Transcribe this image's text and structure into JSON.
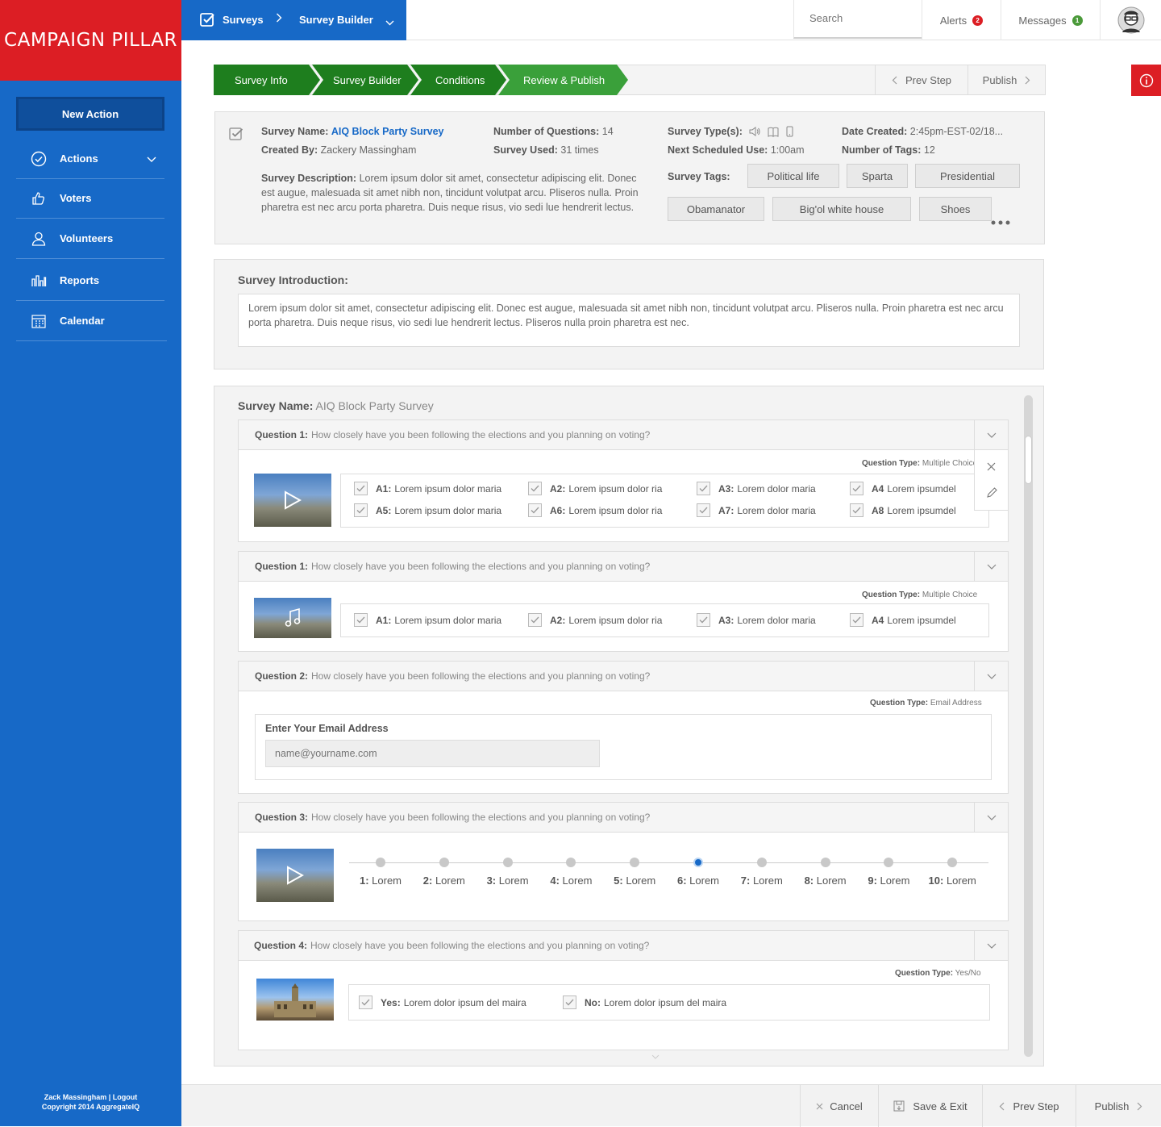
{
  "brand": {
    "logo_text": "CAMPAIGN PILLAR",
    "red": "#dc1e24",
    "blue": "#1769c7",
    "green": "#1e7e1e"
  },
  "sidebar": {
    "new_action": "New Action",
    "items": [
      {
        "label": "Actions",
        "icon": "check-circle-icon"
      },
      {
        "label": "Voters",
        "icon": "thumbs-up-icon"
      },
      {
        "label": "Volunteers",
        "icon": "user-icon"
      },
      {
        "label": "Reports",
        "icon": "bar-chart-icon"
      },
      {
        "label": "Calendar",
        "icon": "calendar-icon"
      }
    ],
    "footer_user": "Zack Massingham",
    "footer_sep": "|",
    "footer_logout": "Logout",
    "footer_copyright": "Copyright 2014 AggregateIQ"
  },
  "topbar": {
    "crumb1": "Surveys",
    "crumb_sep": ">",
    "crumb2": "Survey Builder",
    "search_placeholder": "Search",
    "alerts": "Alerts",
    "alerts_count": "2",
    "messages": "Messages",
    "messages_count": "1"
  },
  "steps": {
    "items": [
      "Survey Info",
      "Survey Builder",
      "Conditions",
      "Review & Publish"
    ],
    "prev": "Prev Step",
    "publish": "Publish"
  },
  "info": {
    "name_label": "Survey Name:",
    "name_value": "AIQ Block Party Survey",
    "created_label": "Created By:",
    "created_value": "Zackery Massingham",
    "questions_label": "Number of Questions:",
    "questions_value": "14",
    "used_label": "Survey Used:",
    "used_value": "31 times",
    "types_label": "Survey Type(s):",
    "next_label": "Next Scheduled Use:",
    "next_value": "1:00am",
    "date_label": "Date Created:",
    "date_value": "2:45pm-EST-02/18...",
    "tagcount_label": "Number of Tags:",
    "tagcount_value": "12",
    "desc_label": "Survey Description:",
    "desc_value": "Lorem ipsum dolor sit amet, consectetur adipiscing elit. Donec est augue, malesuada sit amet nibh non, tincidunt volutpat arcu. Pliseros nulla. Proin pharetra est nec arcu porta pharetra. Duis neque risus, vio sedi lue hendrerit lectus.",
    "tags_label": "Survey Tags:",
    "tags": [
      "Political life",
      "Sparta",
      "Presidential",
      "Obamanator",
      "Big'ol white house",
      "Shoes"
    ]
  },
  "intro": {
    "label": "Survey Introduction:",
    "text": "Lorem ipsum dolor sit amet, consectetur adipiscing elit. Donec est augue, malesuada sit amet nibh non, tincidunt volutpat arcu. Pliseros nulla. Proin pharetra est nec arcu porta pharetra. Duis neque risus, vio sedi lue hendrerit lectus. Pliseros nulla proin pharetra est nec."
  },
  "builder": {
    "name_label": "Survey Name:",
    "name_value": "AIQ Block Party Survey",
    "q_text": "How closely have you been following the elections and you planning on voting?",
    "q1": {
      "label": "Question 1:",
      "type_label": "Question Type:",
      "type_value": "Multiple Choice",
      "answers": [
        {
          "key": "A1:",
          "text": "Lorem ipsum dolor maria"
        },
        {
          "key": "A2:",
          "text": "Lorem ipsum dolor ria"
        },
        {
          "key": "A3:",
          "text": "Lorem dolor maria"
        },
        {
          "key": "A4",
          "text": "Lorem ipsumdel"
        },
        {
          "key": "A5:",
          "text": "Lorem ipsum dolor maria"
        },
        {
          "key": "A6:",
          "text": "Lorem ipsum dolor ria"
        },
        {
          "key": "A7:",
          "text": "Lorem dolor maria"
        },
        {
          "key": "A8",
          "text": "Lorem ipsumdel"
        }
      ]
    },
    "q1b": {
      "label": "Question 1:",
      "type_label": "Question Type:",
      "type_value": "Multiple Choice",
      "answers": [
        {
          "key": "A1:",
          "text": "Lorem ipsum dolor maria"
        },
        {
          "key": "A2:",
          "text": "Lorem ipsum dolor ria"
        },
        {
          "key": "A3:",
          "text": "Lorem dolor maria"
        },
        {
          "key": "A4",
          "text": "Lorem ipsumdel"
        }
      ]
    },
    "q2": {
      "label": "Question 2:",
      "type_label": "Question Type:",
      "type_value": "Email Address",
      "field_label": "Enter Your Email Address",
      "placeholder": "name@yourname.com"
    },
    "q3": {
      "label": "Question 3:",
      "scale": [
        "1: Lorem",
        "2: Lorem",
        "3: Lorem",
        "4: Lorem",
        "5: Lorem",
        "6: Lorem",
        "7: Lorem",
        "8: Lorem",
        "9: Lorem",
        "10: Lorem"
      ],
      "selected_index": 5
    },
    "q4": {
      "label": "Question 4:",
      "type_label": "Question Type:",
      "type_value": "Yes/No",
      "answers": [
        {
          "key": "Yes:",
          "text": "Lorem dolor ipsum del maira"
        },
        {
          "key": "No:",
          "text": "Lorem dolor ipsum del maira"
        }
      ]
    }
  },
  "footer": {
    "cancel": "Cancel",
    "save": "Save & Exit",
    "prev": "Prev Step",
    "publish": "Publish"
  }
}
